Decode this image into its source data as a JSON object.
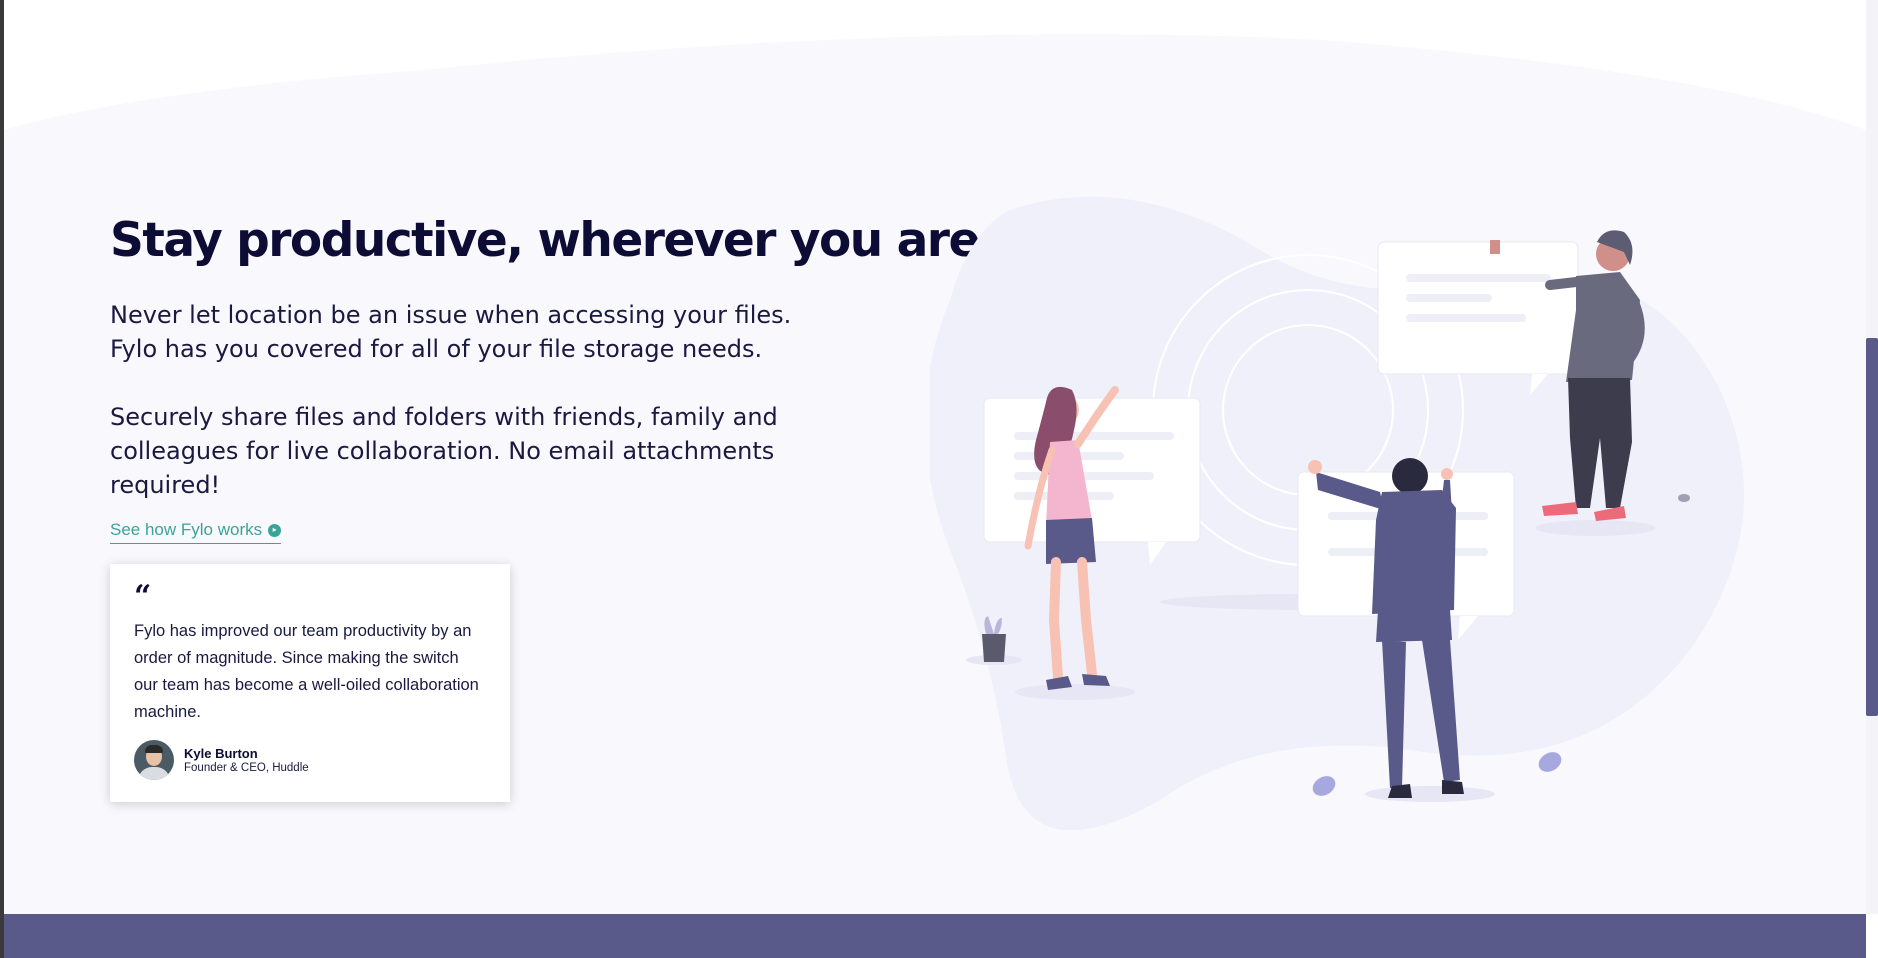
{
  "section": {
    "title": "Stay productive, wherever you are",
    "paragraph_1": "Never let location be an issue when accessing your files. Fylo has you covered for all of your file storage needs.",
    "paragraph_2": "Securely share files and folders with friends, family and colleagues for live collaboration. No email attachments required!",
    "link_label": "See how Fylo works",
    "link_icon": "arrow-circle-icon"
  },
  "testimonial": {
    "quote_icon": "quote-icon",
    "text": "Fylo has improved our team productivity by an order of magnitude. Since making the switch our team has become a well-oiled collaboration machine.",
    "author_name": "Kyle Burton",
    "author_role": "Founder & CEO, Huddle"
  },
  "colors": {
    "heading": "#0d0c35",
    "accent": "#3aa49a",
    "section_bg": "#f8f8fd",
    "footer_band": "#595a89"
  }
}
